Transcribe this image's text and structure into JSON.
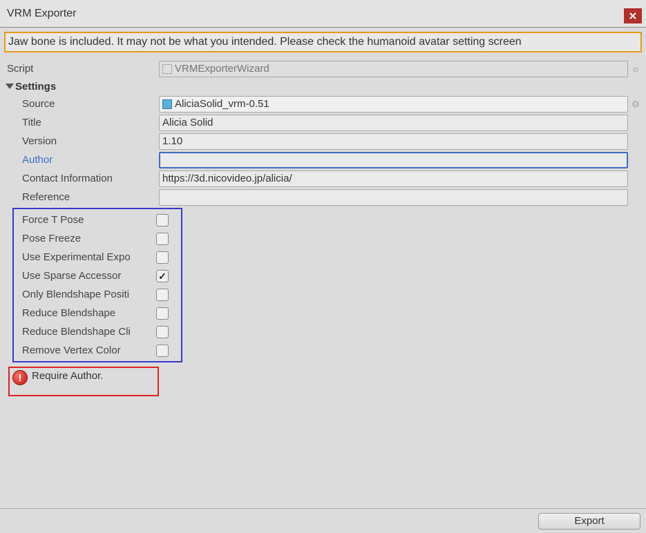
{
  "window": {
    "title": "VRM Exporter",
    "warning": "Jaw bone is included. It may not be what you intended. Please check the humanoid avatar setting screen"
  },
  "inspector": {
    "script_label": "Script",
    "script_value": "VRMExporterWizard",
    "settings_label": "Settings",
    "source_label": "Source",
    "source_value": "AliciaSolid_vrm-0.51",
    "title_label": "Title",
    "title_value": "Alicia Solid",
    "version_label": "Version",
    "version_value": "1.10",
    "author_label": "Author",
    "author_value": "",
    "contact_label": "Contact Information",
    "contact_value": "https://3d.nicovideo.jp/alicia/",
    "reference_label": "Reference",
    "reference_value": ""
  },
  "options": {
    "force_t_pose": {
      "label": "Force T Pose",
      "checked": false
    },
    "pose_freeze": {
      "label": "Pose Freeze",
      "checked": false
    },
    "use_experimental": {
      "label": "Use Experimental Expo",
      "checked": false
    },
    "use_sparse": {
      "label": "Use Sparse Accessor",
      "checked": true
    },
    "only_blendshape": {
      "label": "Only Blendshape Positi",
      "checked": false
    },
    "reduce_blendshape": {
      "label": "Reduce Blendshape",
      "checked": false
    },
    "reduce_blendshape_cli": {
      "label": "Reduce Blendshape Cli",
      "checked": false
    },
    "remove_vertex_color": {
      "label": "Remove Vertex Color",
      "checked": false
    }
  },
  "error": {
    "text": "Require Author."
  },
  "footer": {
    "export_label": "Export"
  }
}
